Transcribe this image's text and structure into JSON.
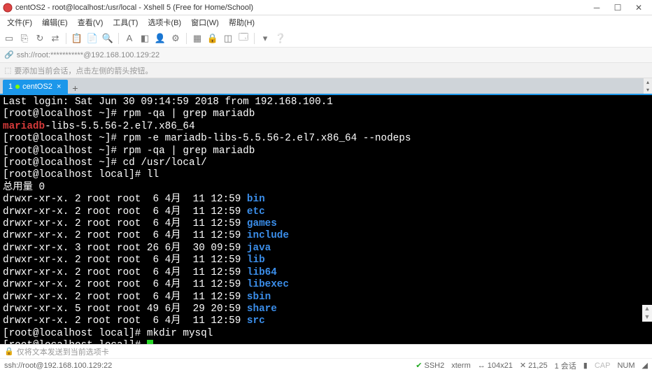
{
  "window": {
    "title": "centOS2 - root@localhost:/usr/local - Xshell 5 (Free for Home/School)"
  },
  "menu": {
    "items": [
      "文件(F)",
      "编辑(E)",
      "查看(V)",
      "工具(T)",
      "选项卡(B)",
      "窗口(W)",
      "帮助(H)"
    ]
  },
  "address": {
    "prefix": "ssh://root:***********@192.168.100.129:22"
  },
  "hint": {
    "text": "要添加当前会话，点击左侧的箭头按钮。"
  },
  "tab": {
    "index": "1",
    "label": "centOS2"
  },
  "terminal": {
    "lines": [
      {
        "t": "plain",
        "s": "Last login: Sat Jun 30 09:14:59 2018 from 192.168.100.1"
      },
      {
        "t": "plain",
        "s": "[root@localhost ~]# rpm -qa | grep mariadb"
      },
      {
        "t": "maria",
        "red": "mariadb",
        "rest": "-libs-5.5.56-2.el7.x86_64"
      },
      {
        "t": "plain",
        "s": "[root@localhost ~]# rpm -e mariadb-libs-5.5.56-2.el7.x86_64 --nodeps"
      },
      {
        "t": "plain",
        "s": "[root@localhost ~]# rpm -qa | grep mariadb"
      },
      {
        "t": "plain",
        "s": "[root@localhost ~]# cd /usr/local/"
      },
      {
        "t": "plain",
        "s": "[root@localhost local]# ll"
      },
      {
        "t": "plain",
        "s": "总用量 0"
      },
      {
        "t": "ls",
        "pre": "drwxr-xr-x. 2 root root  6 4月  11 12:59 ",
        "d": "bin"
      },
      {
        "t": "ls",
        "pre": "drwxr-xr-x. 2 root root  6 4月  11 12:59 ",
        "d": "etc"
      },
      {
        "t": "ls",
        "pre": "drwxr-xr-x. 2 root root  6 4月  11 12:59 ",
        "d": "games"
      },
      {
        "t": "ls",
        "pre": "drwxr-xr-x. 2 root root  6 4月  11 12:59 ",
        "d": "include"
      },
      {
        "t": "ls",
        "pre": "drwxr-xr-x. 3 root root 26 6月  30 09:59 ",
        "d": "java"
      },
      {
        "t": "ls",
        "pre": "drwxr-xr-x. 2 root root  6 4月  11 12:59 ",
        "d": "lib"
      },
      {
        "t": "ls",
        "pre": "drwxr-xr-x. 2 root root  6 4月  11 12:59 ",
        "d": "lib64"
      },
      {
        "t": "ls",
        "pre": "drwxr-xr-x. 2 root root  6 4月  11 12:59 ",
        "d": "libexec"
      },
      {
        "t": "ls",
        "pre": "drwxr-xr-x. 2 root root  6 4月  11 12:59 ",
        "d": "sbin"
      },
      {
        "t": "ls",
        "pre": "drwxr-xr-x. 5 root root 49 6月  29 20:59 ",
        "d": "share"
      },
      {
        "t": "ls",
        "pre": "drwxr-xr-x. 2 root root  6 4月  11 12:59 ",
        "d": "src"
      },
      {
        "t": "plain",
        "s": "[root@localhost local]# mkdir mysql"
      },
      {
        "t": "prompt",
        "s": "[root@localhost local]# "
      }
    ]
  },
  "footer": {
    "note": "仅将文本发送到当前选项卡"
  },
  "status": {
    "conn": "ssh://root@192.168.100.129:22",
    "proto": "SSH2",
    "term": "xterm",
    "size": "104x21",
    "cursor": "21,25",
    "sess": "1 会话",
    "cap": "CAP",
    "num": "NUM"
  }
}
